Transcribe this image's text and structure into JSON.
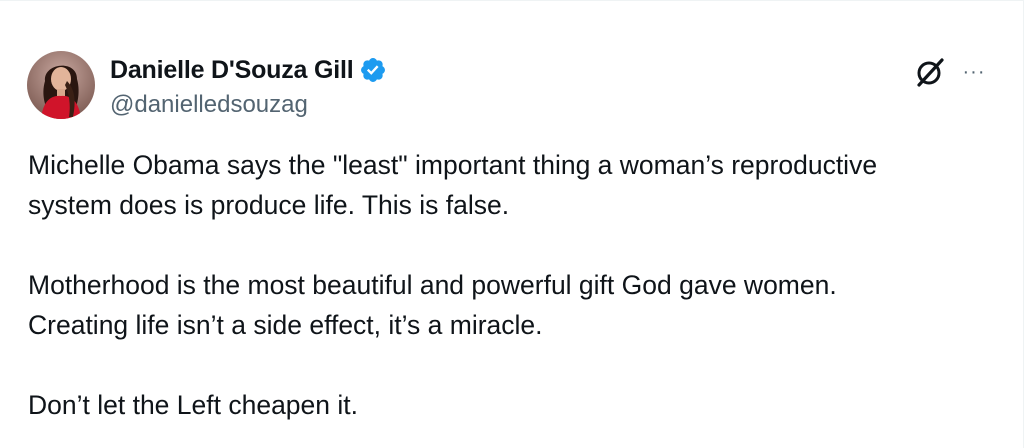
{
  "tweet": {
    "author": {
      "display_name": "Danielle D'Souza Gill",
      "handle": "@danielledsouzag",
      "verified": true,
      "verified_badge_icon": "verified-badge-icon"
    },
    "actions": {
      "grok_icon": "grok-slash-icon",
      "more_icon": "more-options-icon",
      "more_glyph": "···"
    },
    "paragraphs": [
      {
        "line1": "Michelle Obama says the \"least\" important thing a woman’s reproductive",
        "line2": "system does is produce life. This is false."
      },
      {
        "line1": "Motherhood is the most beautiful and powerful gift God gave women.",
        "line2": "Creating life isn’t a side effect, it’s a miracle."
      },
      {
        "line1": "Don’t let the Left cheapen it."
      }
    ]
  },
  "colors": {
    "text_primary": "#0f1419",
    "text_secondary": "#536471",
    "verified_blue": "#1d9bf0",
    "background": "#ffffff"
  }
}
